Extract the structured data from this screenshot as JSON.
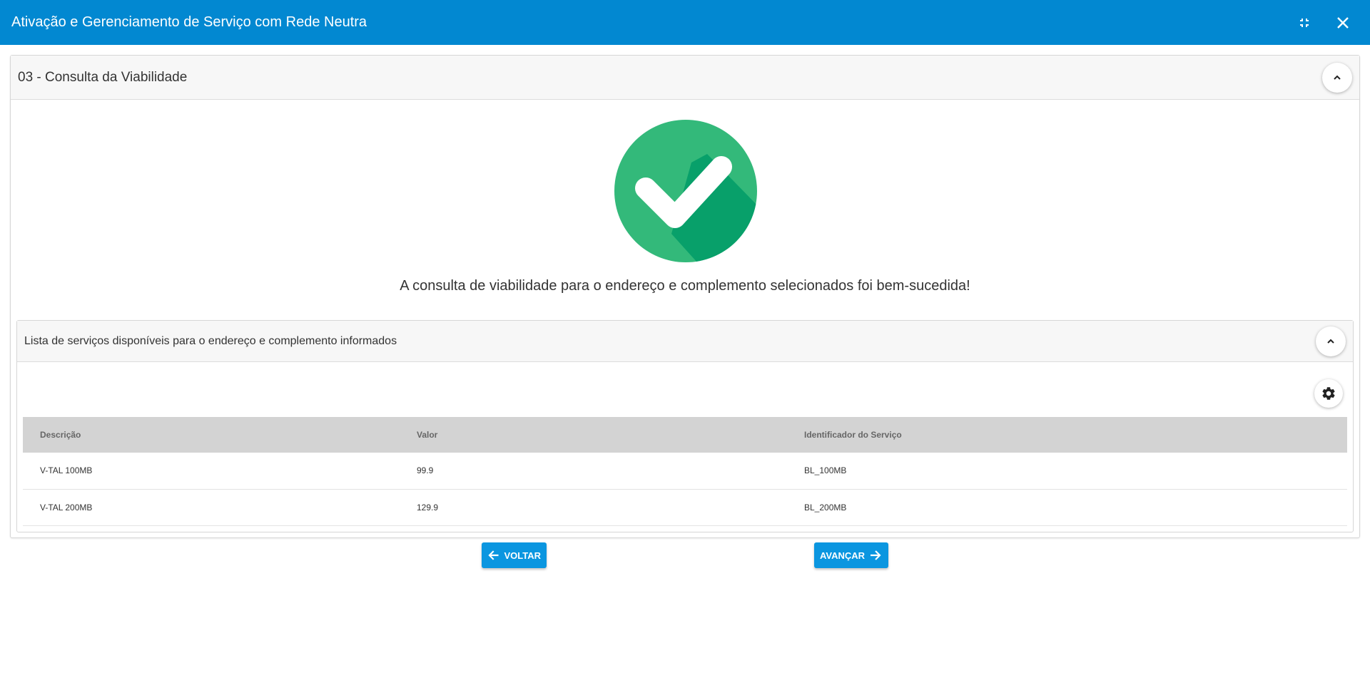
{
  "header": {
    "title": "Ativação e Gerenciamento de Serviço com Rede Neutra",
    "icons": [
      "minimize-icon",
      "close-icon"
    ]
  },
  "step": {
    "title": "03 - Consulta da Viabilidade",
    "success_message": "A consulta de viabilidade para o endereço e complemento selecionados foi bem-sucedida!"
  },
  "services": {
    "title": "Lista de serviços disponíveis para o endereço e complemento informados",
    "columns": [
      "Descrição",
      "Valor",
      "Identificador do Serviço"
    ],
    "rows": [
      [
        "V-TAL 100MB",
        "99.9",
        "BL_100MB"
      ],
      [
        "V-TAL 200MB",
        "129.9",
        "BL_200MB"
      ]
    ]
  },
  "nav": {
    "back_label": "VOLTAR",
    "next_label": "AVANÇAR"
  },
  "colors": {
    "header_bg": "#0288d1",
    "button_bg": "#0b96e0",
    "success_green": "#33b97a",
    "success_green_dark": "#08a06a"
  }
}
